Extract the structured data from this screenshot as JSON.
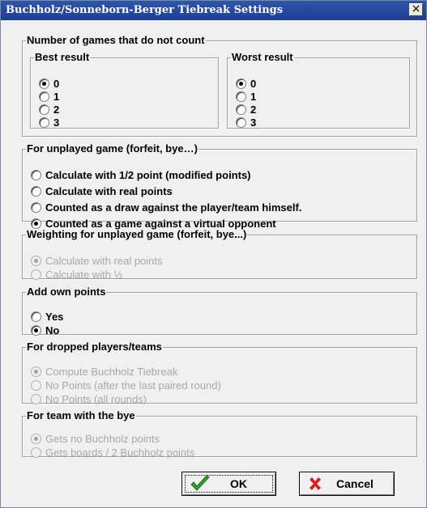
{
  "window": {
    "title": "Buchholz/Sonneborn-Berger Tiebreak Settings",
    "close_glyph": "×"
  },
  "games_not_count": {
    "legend": "Number of games that do not count",
    "best": {
      "legend": "Best result",
      "options": [
        "0",
        "1",
        "2",
        "3"
      ],
      "selected": "0"
    },
    "worst": {
      "legend": "Worst result",
      "options": [
        "0",
        "1",
        "2",
        "3"
      ],
      "selected": "0"
    }
  },
  "unplayed": {
    "legend": "For unplayed game (forfeit, bye…)",
    "options": [
      "Calculate with 1/2 point (modified points)",
      "Calculate with real points",
      "Counted as a draw against the player/team himself.",
      "Counted as a game against a virtual opponent"
    ],
    "selected": "Counted as a game against a virtual opponent"
  },
  "weighting": {
    "legend": "Weighting for unplayed game (forfeit, bye...)",
    "options": [
      "Calculate with real points",
      "Calculate with ½"
    ],
    "selected": "Calculate with real points",
    "enabled": false
  },
  "own_points": {
    "legend": "Add own points",
    "options": [
      "Yes",
      "No"
    ],
    "selected": "No"
  },
  "dropped": {
    "legend": "For dropped players/teams",
    "options": [
      "Compute Buchholz Tiebreak",
      "No Points (after the last paired round)",
      "No Points (all rounds)"
    ],
    "selected": "Compute Buchholz Tiebreak",
    "enabled": false
  },
  "team_bye": {
    "legend": "For team with the bye",
    "options": [
      "Gets no Buchholz points",
      "Gets boards / 2 Buchholz points"
    ],
    "selected": "Gets no Buchholz points",
    "enabled": false
  },
  "buttons": {
    "ok_label": "OK",
    "cancel_label": "Cancel",
    "ok_icon": "green-check-icon",
    "cancel_icon": "red-x-icon"
  },
  "colors": {
    "titlebar": "#1c3f93",
    "dialog_bg": "#f0f0f0",
    "disabled_text": "#a8a8a8",
    "check_green": "#2e9e2e",
    "cancel_red": "#d42020"
  }
}
